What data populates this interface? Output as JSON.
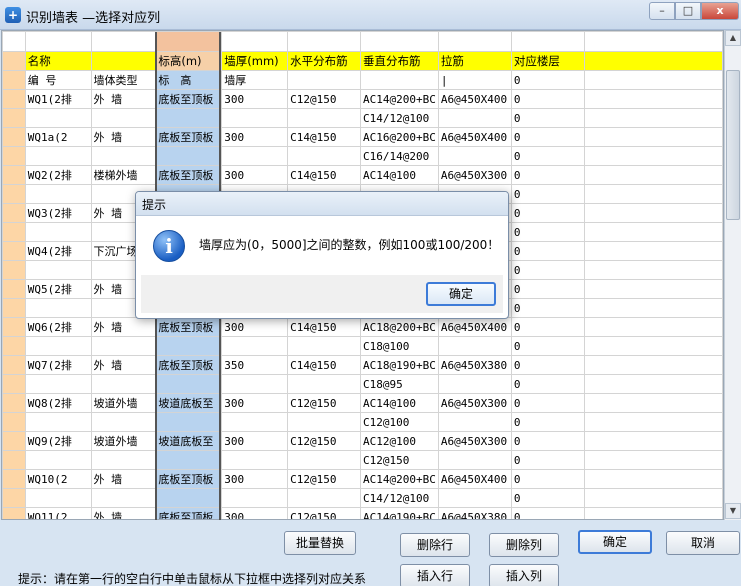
{
  "window": {
    "title": "识别墙表 —选择对应列",
    "min_glyph": "–",
    "max_glyph": "□",
    "close_glyph": "x"
  },
  "grid": {
    "headers": [
      "名称",
      "标高(m)",
      "墙厚(mm)",
      "水平分布筋",
      "垂直分布筋",
      "拉筋",
      "对应楼层"
    ],
    "rows": [
      [
        "编 号",
        "墙体类型",
        "标　高",
        "墙厚",
        "",
        "",
        "|",
        "0"
      ],
      [
        "WQ1(2排",
        "外 墙",
        "底板至顶板",
        "300",
        "C12@150",
        "AC14@200+BC",
        "A6@450X400",
        "0"
      ],
      [
        "",
        "",
        "",
        "",
        "",
        "C14/12@100",
        "",
        "0"
      ],
      [
        "WQ1a(2",
        "外 墙",
        "底板至顶板",
        "300",
        "C14@150",
        "AC16@200+BC",
        "A6@450X400",
        "0"
      ],
      [
        "",
        "",
        "",
        "",
        "",
        "C16/14@200",
        "",
        "0"
      ],
      [
        "WQ2(2排",
        "楼梯外墙",
        "底板至顶板",
        "300",
        "C14@150",
        "AC14@100",
        "A6@450X300",
        "0"
      ],
      [
        "",
        "",
        "",
        "",
        "",
        "",
        "",
        "0"
      ],
      [
        "WQ3(2排",
        "外 墙",
        "",
        "",
        "",
        "",
        "",
        "0"
      ],
      [
        "",
        "",
        "",
        "",
        "",
        "",
        "",
        "0"
      ],
      [
        "WQ4(2排",
        "下沉广场",
        "",
        "",
        "",
        "",
        "",
        "0"
      ],
      [
        "",
        "",
        "",
        "",
        "",
        "",
        "",
        "0"
      ],
      [
        "WQ5(2排",
        "外 墙",
        "",
        "",
        "",
        "",
        "",
        "0"
      ],
      [
        "",
        "",
        "",
        "",
        "",
        "",
        "",
        "0"
      ],
      [
        "WQ6(2排",
        "外 墙",
        "底板至顶板",
        "300",
        "C14@150",
        "AC18@200+BC",
        "A6@450X400",
        "0"
      ],
      [
        "",
        "",
        "",
        "",
        "",
        "C18@100",
        "",
        "0"
      ],
      [
        "WQ7(2排",
        "外 墙",
        "底板至顶板",
        "350",
        "C14@150",
        "AC18@190+BC",
        "A6@450X380",
        "0"
      ],
      [
        "",
        "",
        "",
        "",
        "",
        "C18@95",
        "",
        "0"
      ],
      [
        "WQ8(2排",
        "坡道外墙",
        "坡道底板至",
        "300",
        "C12@150",
        "AC14@100",
        "A6@450X300",
        "0"
      ],
      [
        "",
        "",
        "",
        "",
        "",
        "C12@100",
        "",
        "0"
      ],
      [
        "WQ9(2排",
        "坡道外墙",
        "坡道底板至",
        "300",
        "C12@150",
        "AC12@100",
        "A6@450X300",
        "0"
      ],
      [
        "",
        "",
        "",
        "",
        "",
        "C12@150",
        "",
        "0"
      ],
      [
        "WQ10(2",
        "外 墙",
        "底板至顶板",
        "300",
        "C12@150",
        "AC14@200+BC",
        "A6@450X400",
        "0"
      ],
      [
        "",
        "",
        "",
        "",
        "",
        "C14/12@100",
        "",
        "0"
      ],
      [
        "WQ11(2",
        "外 墙",
        "底板至顶板",
        "300",
        "C12@150",
        "AC14@190+BC",
        "A6@450X380",
        "0"
      ]
    ]
  },
  "buttons": {
    "batch_replace": "批量替换",
    "delete_row": "删除行",
    "delete_col": "删除列",
    "confirm": "确定",
    "cancel": "取消",
    "insert_row": "插入行",
    "insert_col": "插入列"
  },
  "hint": "提示：请在第一行的空白行中单击鼠标从下拉框中选择列对应关系",
  "dialog": {
    "title": "提示",
    "icon_glyph": "i",
    "message": "墙厚应为(0，5000]之间的整数，例如100或100/200！",
    "ok_label": "确定"
  }
}
